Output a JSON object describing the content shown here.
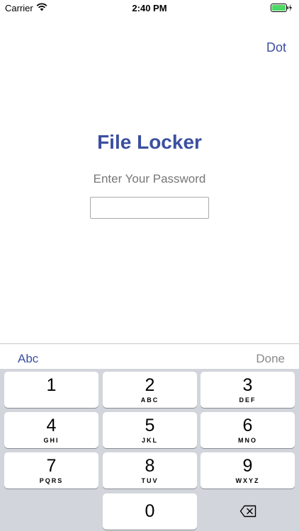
{
  "status_bar": {
    "carrier": "Carrier",
    "time": "2:40 PM",
    "wifi_icon": "wifi-icon",
    "battery_icon": "battery-icon"
  },
  "nav": {
    "right_button": "Dot"
  },
  "main": {
    "title": "File Locker",
    "prompt": "Enter Your Password",
    "password_value": ""
  },
  "keyboard_toolbar": {
    "left": "Abc",
    "right": "Done"
  },
  "keypad": {
    "keys": [
      {
        "digit": "1",
        "letters": ""
      },
      {
        "digit": "2",
        "letters": "ABC"
      },
      {
        "digit": "3",
        "letters": "DEF"
      },
      {
        "digit": "4",
        "letters": "GHI"
      },
      {
        "digit": "5",
        "letters": "JKL"
      },
      {
        "digit": "6",
        "letters": "MNO"
      },
      {
        "digit": "7",
        "letters": "PQRS"
      },
      {
        "digit": "8",
        "letters": "TUV"
      },
      {
        "digit": "9",
        "letters": "WXYZ"
      },
      {
        "digit": "0",
        "letters": ""
      }
    ],
    "delete_icon": "backspace-icon"
  },
  "colors": {
    "accent": "#3c4fa0",
    "keyboard_bg": "#d2d5db",
    "key_bg": "#ffffff",
    "muted": "#8a8a8a"
  }
}
